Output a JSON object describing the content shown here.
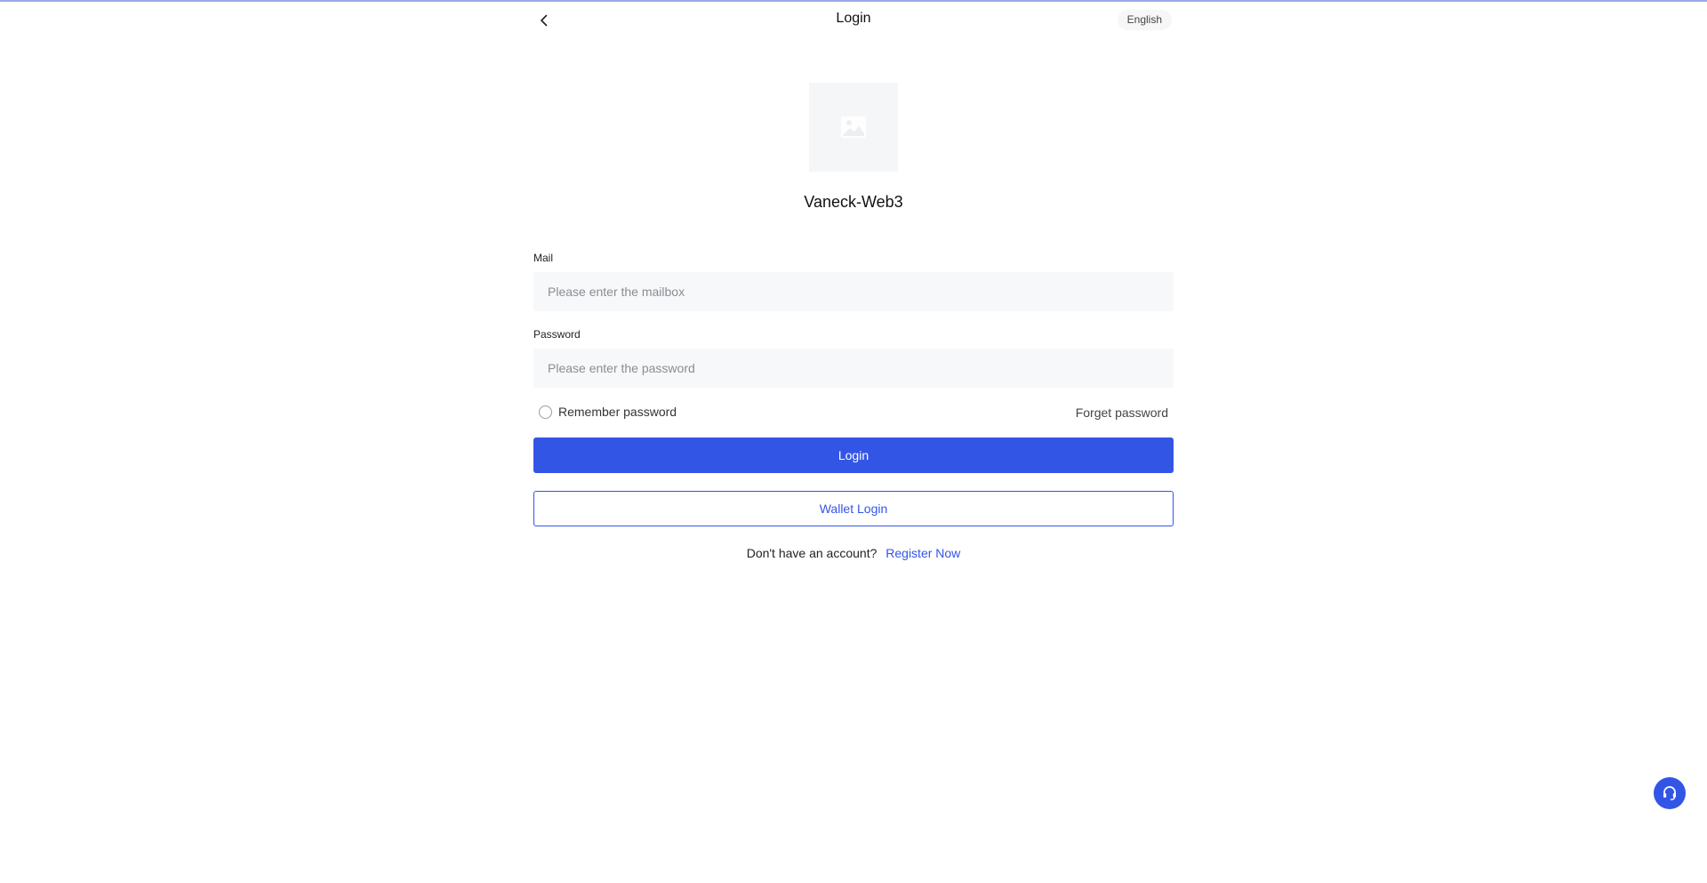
{
  "header": {
    "title": "Login",
    "language": "English",
    "back_icon": "chevron-left-icon"
  },
  "brand": {
    "logo_icon": "image-placeholder-icon",
    "name": "Vaneck-Web3"
  },
  "form": {
    "mail_label": "Mail",
    "mail_placeholder": "Please enter the mailbox",
    "mail_value": "",
    "password_label": "Password",
    "password_placeholder": "Please enter the password",
    "password_value": "",
    "remember_label": "Remember password",
    "remember_checked": false,
    "forget_label": "Forget password",
    "login_label": "Login",
    "wallet_login_label": "Wallet Login"
  },
  "register": {
    "prompt": "Don't have an account?",
    "link": "Register Now"
  },
  "support": {
    "icon": "headset-icon"
  },
  "colors": {
    "accent": "#3355e6",
    "input_bg": "#f7f8fa"
  }
}
